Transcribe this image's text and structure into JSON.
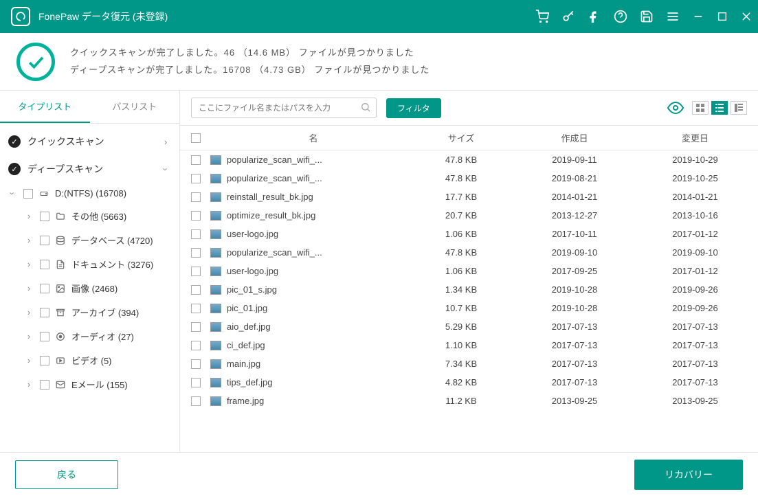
{
  "titlebar": {
    "title": "FonePaw データ復元 (未登録)"
  },
  "summary": {
    "line1": "クイックスキャンが完了しました。46 （14.6 MB） ファイルが見つかりました",
    "line2": "ディープスキャンが完了しました。16708 （4.73 GB） ファイルが見つかりました"
  },
  "sidebar": {
    "tabs": {
      "type": "タイプリスト",
      "path": "パスリスト"
    },
    "scans": {
      "quick": "クイックスキャン",
      "deep": "ディープスキャン"
    },
    "drive": "D:(NTFS) (16708)",
    "categories": [
      {
        "label": "その他 (5663)"
      },
      {
        "label": "データベース (4720)"
      },
      {
        "label": "ドキュメント (3276)"
      },
      {
        "label": "画像 (2468)"
      },
      {
        "label": "アーカイブ (394)"
      },
      {
        "label": "オーディオ (27)"
      },
      {
        "label": "ビデオ (5)"
      },
      {
        "label": "Eメール (155)"
      }
    ]
  },
  "toolbar": {
    "search_placeholder": "ここにファイル名またはパスを入力",
    "filter": "フィルタ"
  },
  "table": {
    "headers": {
      "name": "名",
      "size": "サイズ",
      "created": "作成日",
      "modified": "変更日"
    },
    "rows": [
      {
        "name": "popularize_scan_wifi_...",
        "size": "47.8 KB",
        "created": "2019-09-11",
        "modified": "2019-10-29"
      },
      {
        "name": "popularize_scan_wifi_...",
        "size": "47.8 KB",
        "created": "2019-08-21",
        "modified": "2019-10-25"
      },
      {
        "name": "reinstall_result_bk.jpg",
        "size": "17.7 KB",
        "created": "2014-01-21",
        "modified": "2014-01-21"
      },
      {
        "name": "optimize_result_bk.jpg",
        "size": "20.7 KB",
        "created": "2013-12-27",
        "modified": "2013-10-16"
      },
      {
        "name": "user-logo.jpg",
        "size": "1.06 KB",
        "created": "2017-10-11",
        "modified": "2017-01-12"
      },
      {
        "name": "popularize_scan_wifi_...",
        "size": "47.8 KB",
        "created": "2019-09-10",
        "modified": "2019-09-10"
      },
      {
        "name": "user-logo.jpg",
        "size": "1.06 KB",
        "created": "2017-09-25",
        "modified": "2017-01-12"
      },
      {
        "name": "pic_01_s.jpg",
        "size": "1.34 KB",
        "created": "2019-10-28",
        "modified": "2019-09-26"
      },
      {
        "name": "pic_01.jpg",
        "size": "10.7 KB",
        "created": "2019-10-28",
        "modified": "2019-09-26"
      },
      {
        "name": "aio_def.jpg",
        "size": "5.29 KB",
        "created": "2017-07-13",
        "modified": "2017-07-13"
      },
      {
        "name": "ci_def.jpg",
        "size": "1.10 KB",
        "created": "2017-07-13",
        "modified": "2017-07-13"
      },
      {
        "name": "main.jpg",
        "size": "7.34 KB",
        "created": "2017-07-13",
        "modified": "2017-07-13"
      },
      {
        "name": "tips_def.jpg",
        "size": "4.82 KB",
        "created": "2017-07-13",
        "modified": "2017-07-13"
      },
      {
        "name": "frame.jpg",
        "size": "11.2 KB",
        "created": "2013-09-25",
        "modified": "2013-09-25"
      }
    ]
  },
  "footer": {
    "back": "戻る",
    "recover": "リカバリー"
  }
}
